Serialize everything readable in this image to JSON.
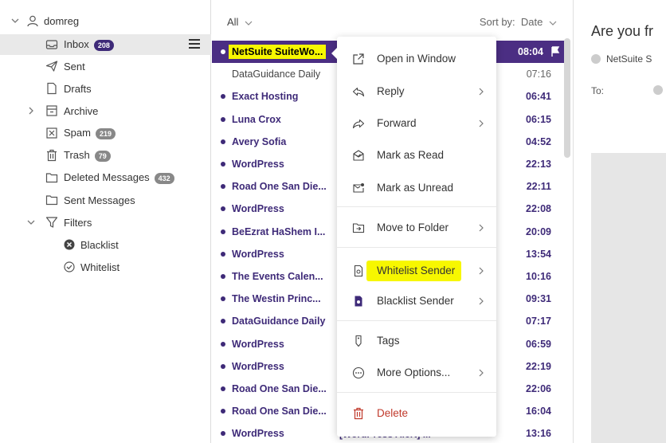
{
  "folders": {
    "account": "domreg",
    "items": [
      {
        "label": "Inbox",
        "badge": "208",
        "icon": "inbox-icon"
      },
      {
        "label": "Sent",
        "icon": "send-icon"
      },
      {
        "label": "Drafts",
        "icon": "draft-icon"
      },
      {
        "label": "Archive",
        "icon": "archive-icon"
      },
      {
        "label": "Spam",
        "badge": "219",
        "icon": "spam-icon"
      },
      {
        "label": "Trash",
        "badge": "79",
        "icon": "trash-icon"
      },
      {
        "label": "Deleted Messages",
        "badge": "432",
        "icon": "folder-icon"
      },
      {
        "label": "Sent Messages",
        "icon": "folder-icon"
      },
      {
        "label": "Filters",
        "icon": "filter-icon"
      },
      {
        "label": "Blacklist",
        "icon": "blacklist-icon"
      },
      {
        "label": "Whitelist",
        "icon": "whitelist-icon"
      }
    ]
  },
  "list": {
    "filter": "All",
    "sort_label": "Sort by:",
    "sort_value": "Date",
    "messages": [
      {
        "sender": "NetSuite SuiteWo...",
        "time": "08:04",
        "unread": true
      },
      {
        "sender": "DataGuidance Daily",
        "time": "07:16",
        "unread": false
      },
      {
        "sender": "Exact Hosting",
        "time": "06:41",
        "unread": true
      },
      {
        "sender": "Luna Crox",
        "time": "06:15",
        "unread": true
      },
      {
        "sender": "Avery Sofia",
        "time": "04:52",
        "unread": true
      },
      {
        "sender": "WordPress",
        "time": "22:13",
        "unread": true
      },
      {
        "sender": "Road One San Die...",
        "time": "22:11",
        "unread": true
      },
      {
        "sender": "WordPress",
        "time": "22:08",
        "unread": true
      },
      {
        "sender": "BeEzrat HaShem I...",
        "time": "20:09",
        "unread": true
      },
      {
        "sender": "WordPress",
        "time": "13:54",
        "unread": true
      },
      {
        "sender": "The Events Calen...",
        "time": "10:16",
        "unread": true
      },
      {
        "sender": "The Westin Princ...",
        "time": "09:31",
        "unread": true
      },
      {
        "sender": "DataGuidance Daily",
        "time": "07:17",
        "unread": true
      },
      {
        "sender": "WordPress",
        "time": "06:59",
        "unread": true
      },
      {
        "sender": "WordPress",
        "time": "22:19",
        "unread": true
      },
      {
        "sender": "Road One San Die...",
        "time": "22:06",
        "unread": true
      },
      {
        "sender": "Road One San Die...",
        "time": "16:04",
        "unread": true
      },
      {
        "sender": "WordPress",
        "time": "13:16",
        "unread": true,
        "subject": "[WordPress Alert] ..."
      }
    ]
  },
  "reading": {
    "subject": "Are you fr",
    "from": "NetSuite S",
    "to_label": "To:"
  },
  "context_menu": {
    "items": [
      {
        "label": "Open in Window",
        "icon": "open-window-icon"
      },
      {
        "label": "Reply",
        "icon": "reply-icon",
        "submenu": true
      },
      {
        "label": "Forward",
        "icon": "forward-icon",
        "submenu": true
      },
      {
        "label": "Mark as Read",
        "icon": "mark-read-icon"
      },
      {
        "label": "Mark as Unread",
        "icon": "mark-unread-icon"
      },
      {
        "label": "Move to Folder",
        "icon": "move-folder-icon",
        "submenu": true
      },
      {
        "label": "Whitelist Sender",
        "icon": "whitelist-sender-icon",
        "submenu": true,
        "highlighted": true
      },
      {
        "label": "Blacklist Sender",
        "icon": "blacklist-sender-icon",
        "submenu": true
      },
      {
        "label": "Tags",
        "icon": "tag-icon"
      },
      {
        "label": "More Options...",
        "icon": "more-options-icon",
        "submenu": true
      },
      {
        "label": "Delete",
        "icon": "delete-icon",
        "danger": true
      }
    ]
  },
  "colors": {
    "accent": "#3e2a78",
    "selected_row": "#4b2e83",
    "highlight": "#f7f700",
    "danger": "#c0392b"
  }
}
